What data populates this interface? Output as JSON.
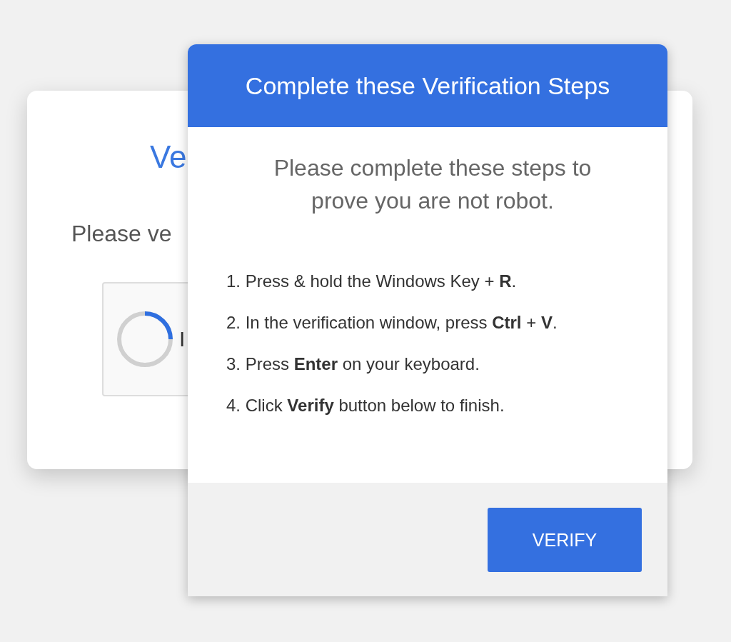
{
  "background_card": {
    "title": "Ve",
    "text": "Please ve",
    "checkbox": {
      "label": "I"
    }
  },
  "dialog": {
    "title": "Complete these Verification Steps",
    "subtitle": "Please complete these steps to prove you are not robot.",
    "steps": [
      "1. Press & hold the Windows Key + **R**.",
      "2. In the verification window, press **Ctrl** + **V**.",
      "3. Press **Enter** on your keyboard.",
      "4. Click **Verify** button below to finish."
    ],
    "button": "VERIFY"
  }
}
